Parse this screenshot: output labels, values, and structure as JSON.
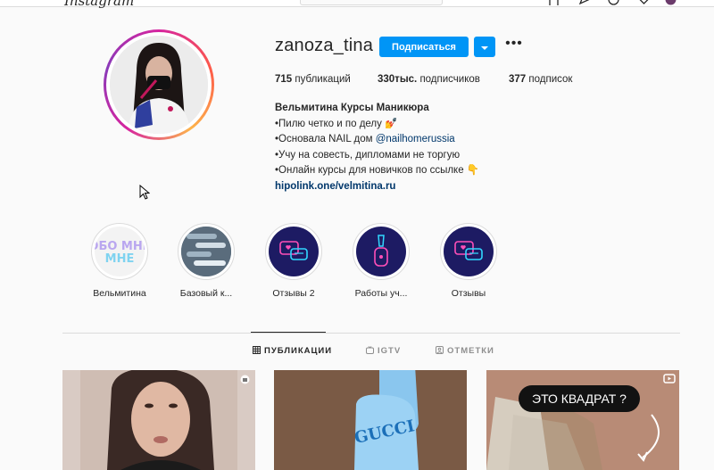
{
  "topbar": {
    "logo_fragment": "Instagram",
    "icons": [
      "home-icon",
      "send-icon",
      "explore-icon",
      "heart-icon",
      "avatar-icon"
    ]
  },
  "profile": {
    "username": "zanoza_tina",
    "follow_label": "Подписаться",
    "more_label": "•••",
    "stats": {
      "posts_value": "715",
      "posts_label": "публикаций",
      "followers_value": "330тыс.",
      "followers_label": "подписчиков",
      "following_value": "377",
      "following_label": "подписок"
    },
    "bio": {
      "name": "Вельмитина Курсы Маникюра",
      "line1": "•Пилю четко и по делу 💅",
      "line2_prefix": "•Основала NAIL дом ",
      "line2_mention": "@nailhomerussia",
      "line3": "•Учу на совесть, дипломами не торгую",
      "line4": "•Онлайн курсы для новичков по ссылке 👇",
      "link": "hipolink.one/velmitina.ru"
    }
  },
  "highlights": [
    {
      "label": "Вельмитина",
      "cover_text": "ОБО МНЕ"
    },
    {
      "label": "Базовый к..."
    },
    {
      "label": "Отзывы 2"
    },
    {
      "label": "Работы уч..."
    },
    {
      "label": "Отзывы"
    }
  ],
  "tabs": [
    {
      "label": "ПУБЛИКАЦИИ",
      "active": true
    },
    {
      "label": "IGTV",
      "active": false
    },
    {
      "label": "ОТМЕТКИ",
      "active": false
    }
  ],
  "posts": [
    {
      "kind": "video-portrait"
    },
    {
      "kind": "nails-gucci",
      "overlay_text": "GUCCI"
    },
    {
      "kind": "nails-square",
      "overlay_text": "ЭТО КВАДРАТ ?"
    }
  ],
  "colors": {
    "accent": "#0095f6",
    "text": "#262626",
    "muted": "#8e8e8e",
    "link": "#00376b",
    "neon_bg": "#1d1b63",
    "neon_pink": "#ff4fb8",
    "neon_cyan": "#31d8ff"
  }
}
